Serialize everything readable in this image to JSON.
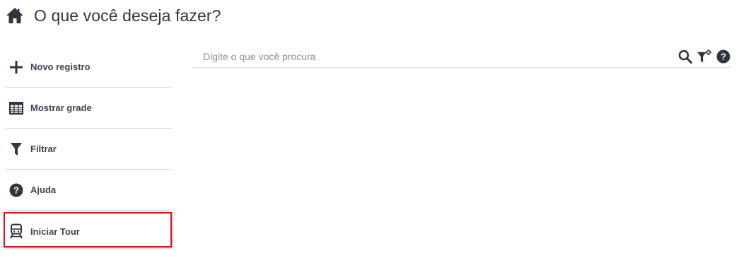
{
  "header": {
    "title": "O que você deseja fazer?",
    "icon": "home-icon"
  },
  "sidebar": {
    "items": [
      {
        "label": "Novo registro",
        "icon": "plus-icon"
      },
      {
        "label": "Mostrar grade",
        "icon": "table-grid-icon"
      },
      {
        "label": "Filtrar",
        "icon": "filter-icon"
      },
      {
        "label": "Ajuda",
        "icon": "question-circle-icon"
      },
      {
        "label": "Iniciar Tour",
        "icon": "train-icon",
        "highlighted": true
      }
    ]
  },
  "search": {
    "placeholder": "Digite o que você procura",
    "value": "",
    "tools": [
      "search-icon",
      "filter-settings-icon",
      "help-icon"
    ]
  },
  "colors": {
    "text": "#3d4451",
    "divider": "#d9dbde",
    "highlight_border": "#e0161b",
    "placeholder": "#8a8f96"
  }
}
